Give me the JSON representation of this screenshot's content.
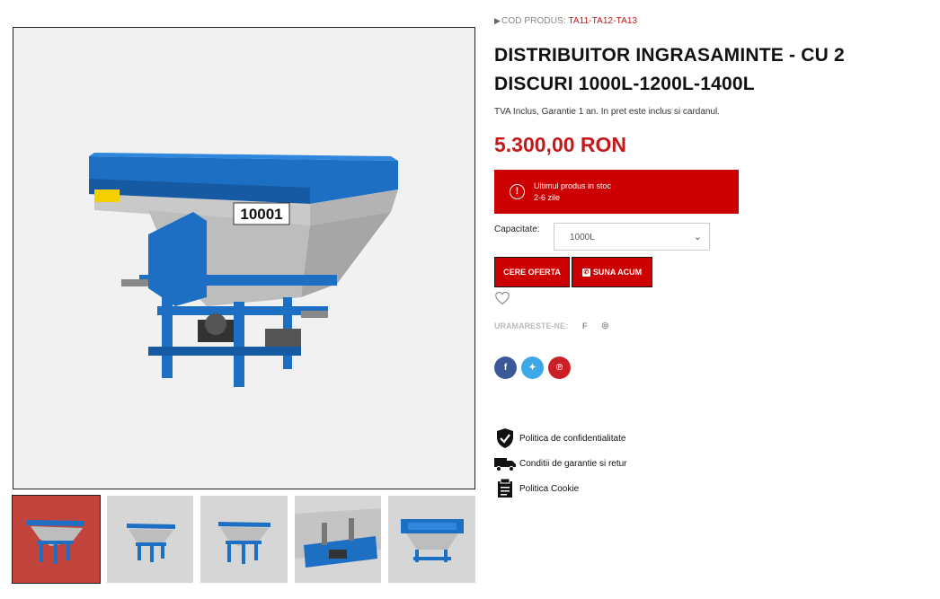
{
  "product": {
    "code_label": "COD PRODUS:",
    "code_value": "TA11-TA12-TA13",
    "title": "DISTRIBUITOR INGRASAMINTE - CU 2 DISCURI 1000L-1200L-1400L",
    "subtitle": "TVA Inclus, Garantie 1 an. In pret este inclus si cardanul.",
    "price": "5.300,00 RON",
    "stock_line1": "Ultimul produs in stoc",
    "stock_line2": "2-6 zile",
    "capacity_label": "Capacitate:",
    "capacity_value": "1000L",
    "offer_button": "CERE OFERTA",
    "call_button": "SUNA ACUM",
    "follow_label": "URAMARESTE-NE:"
  },
  "gallery": {
    "main_image_label": "10001",
    "thumbnail_count": 5
  },
  "policies": [
    {
      "label": "Politica de confidentialitate",
      "icon": "shield-check-icon"
    },
    {
      "label": "Conditii de garantie si retur",
      "icon": "truck-icon"
    },
    {
      "label": "Politica Cookie",
      "icon": "document-icon"
    }
  ],
  "colors": {
    "accent": "#cc0000",
    "machine_blue": "#1d6fc4",
    "facebook": "#3b5998",
    "twitter": "#3ea7e8",
    "pinterest": "#cb2027"
  }
}
